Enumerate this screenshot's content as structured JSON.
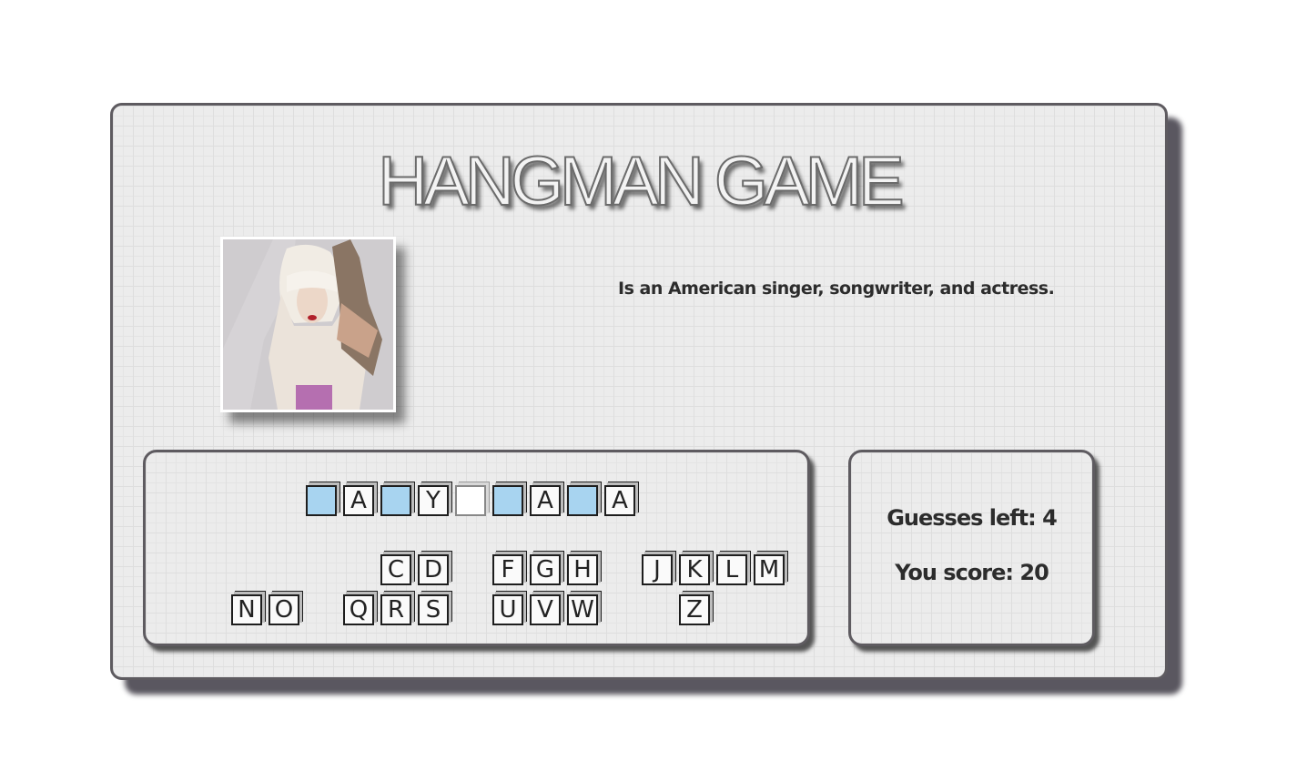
{
  "title": "HANGMAN GAME",
  "hint": "Is an American singer, songwriter, and actress.",
  "photo": {
    "alt": "Celebrity photo clue"
  },
  "word": [
    "",
    "A",
    "",
    "Y",
    " ",
    "",
    "A",
    "",
    "A"
  ],
  "letters": {
    "row1": [
      "C",
      "D",
      "F",
      "G",
      "H",
      "J",
      "K",
      "L",
      "M"
    ],
    "row2": [
      "N",
      "O",
      "Q",
      "R",
      "S",
      "U",
      "V",
      "W",
      "Z"
    ]
  },
  "score_panel": {
    "guesses_left": "Guesses left: 4",
    "score": "You score: 20"
  },
  "colors": {
    "blank_tile": "#a8d4f0",
    "frame": "#5e5b60"
  }
}
